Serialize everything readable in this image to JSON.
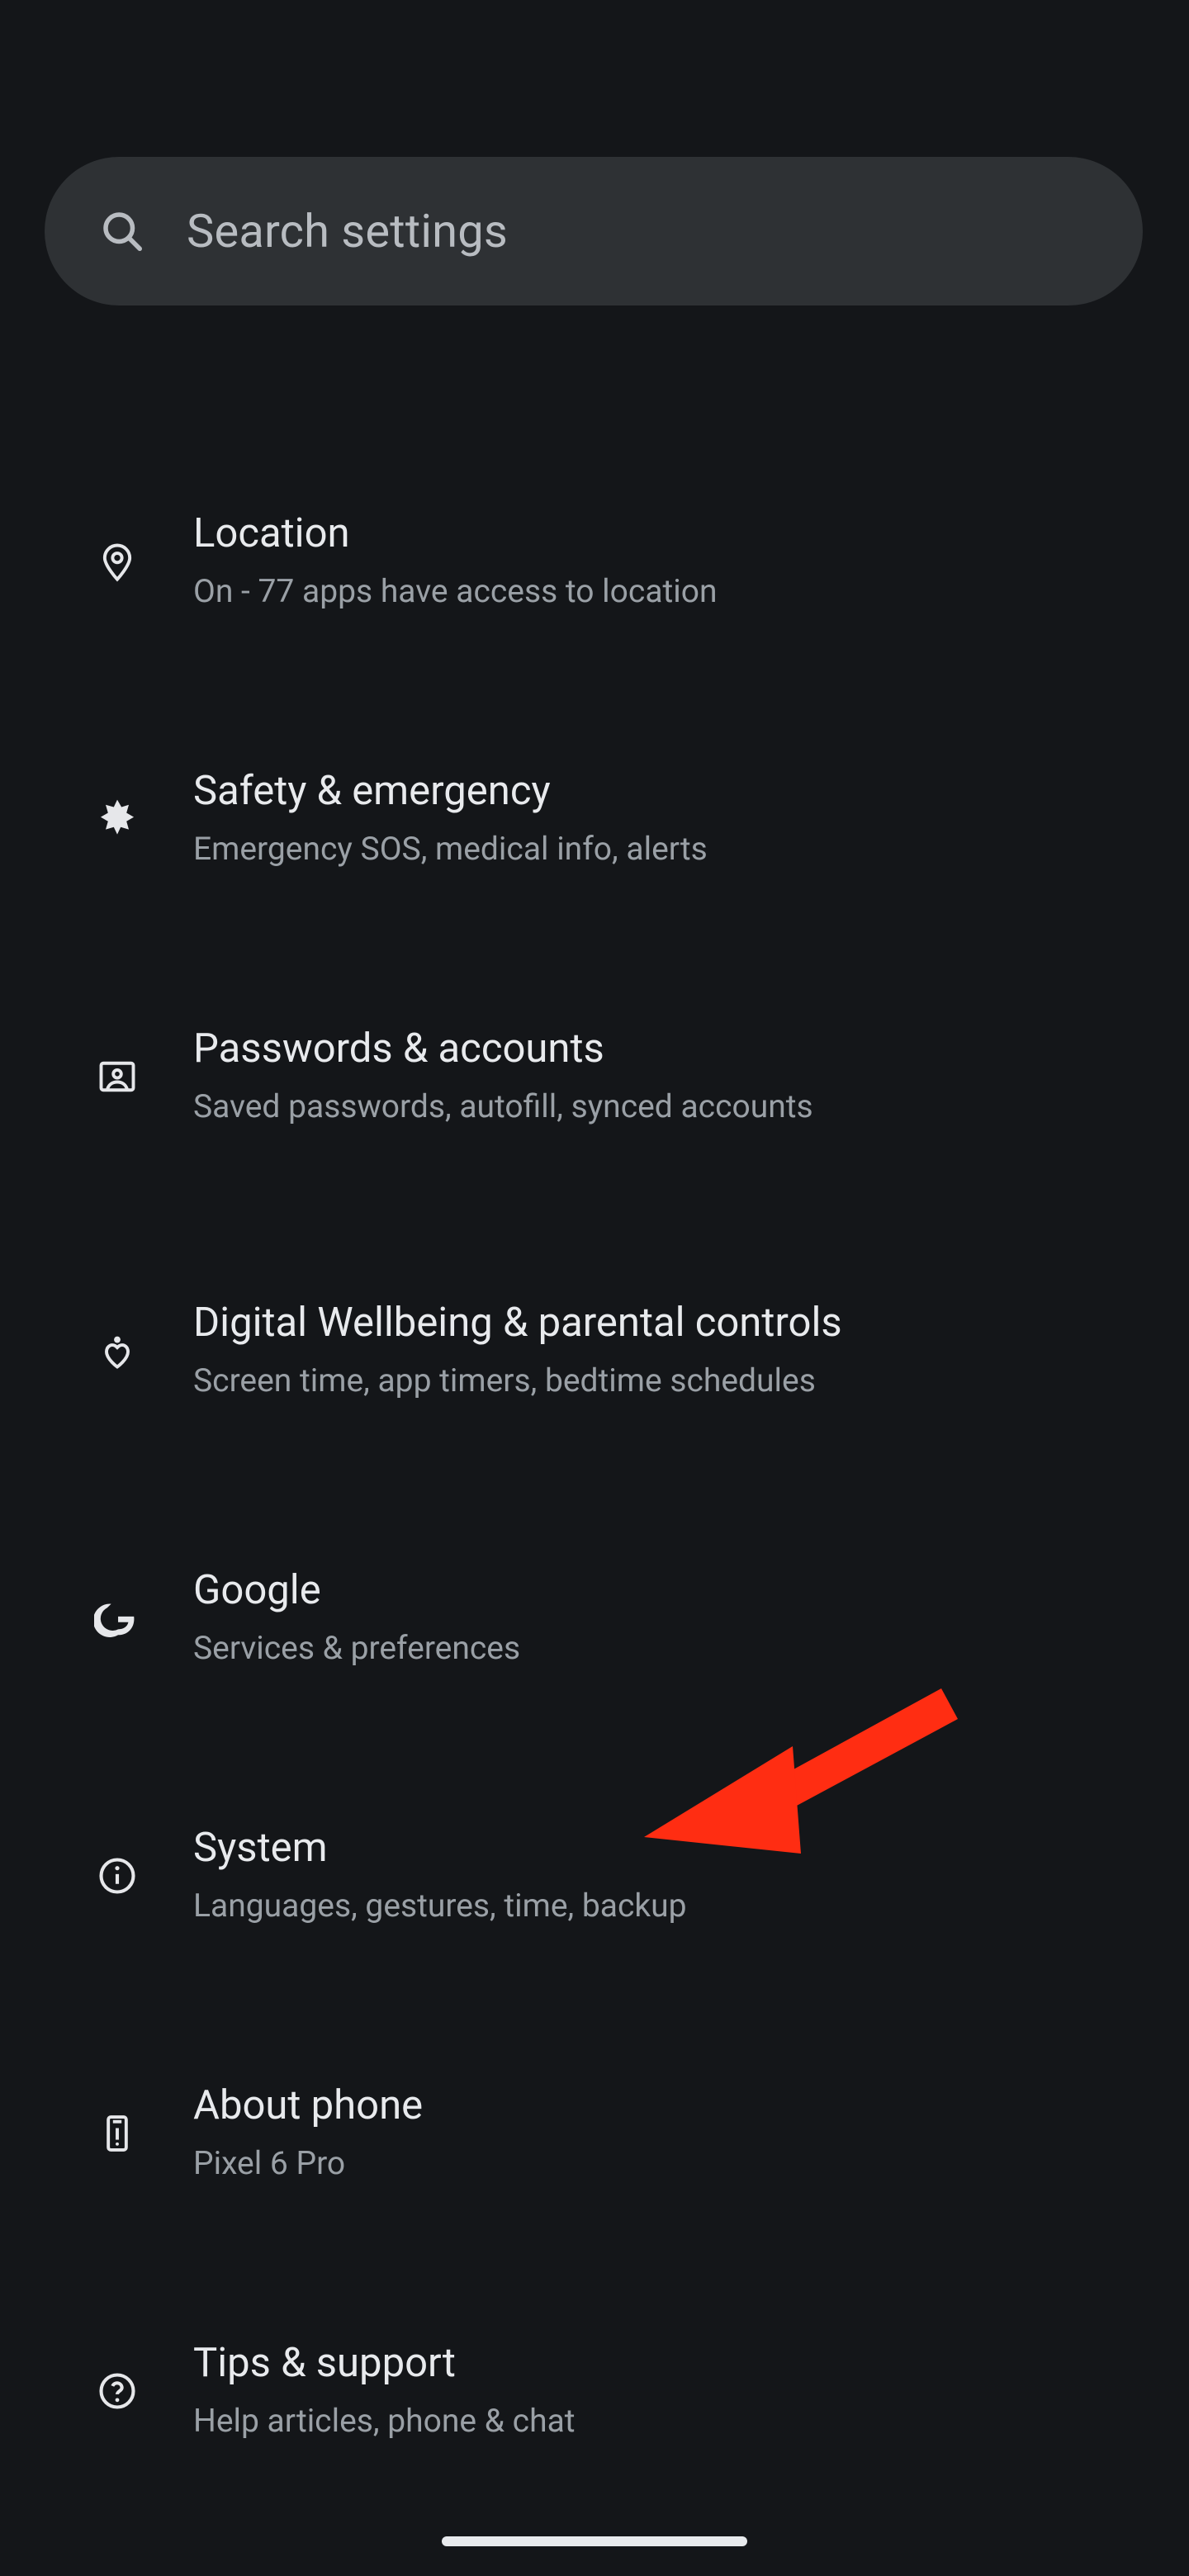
{
  "search": {
    "placeholder": "Search settings",
    "icon_name": "search-icon"
  },
  "rows": [
    {
      "icon": "location-pin-icon",
      "title": "Location",
      "subtitle": "On - 77 apps have access to location"
    },
    {
      "icon": "medical-icon",
      "title": "Safety & emergency",
      "subtitle": "Emergency SOS, medical info, alerts"
    },
    {
      "icon": "account-box-icon",
      "title": "Passwords & accounts",
      "subtitle": "Saved passwords, autofill, synced accounts"
    },
    {
      "icon": "wellbeing-icon",
      "title": "Digital Wellbeing & parental controls",
      "subtitle": "Screen time, app timers, bedtime schedules"
    },
    {
      "icon": "google-g-icon",
      "title": "Google",
      "subtitle": "Services & preferences"
    },
    {
      "icon": "info-icon",
      "title": "System",
      "subtitle": "Languages, gestures, time, backup"
    },
    {
      "icon": "phone-device-icon",
      "title": "About phone",
      "subtitle": "Pixel 6 Pro"
    },
    {
      "icon": "help-icon",
      "title": "Tips & support",
      "subtitle": "Help articles, phone & chat"
    }
  ],
  "annotation": {
    "type": "arrow",
    "target_row_title": "System",
    "color": "#ff2d12"
  }
}
